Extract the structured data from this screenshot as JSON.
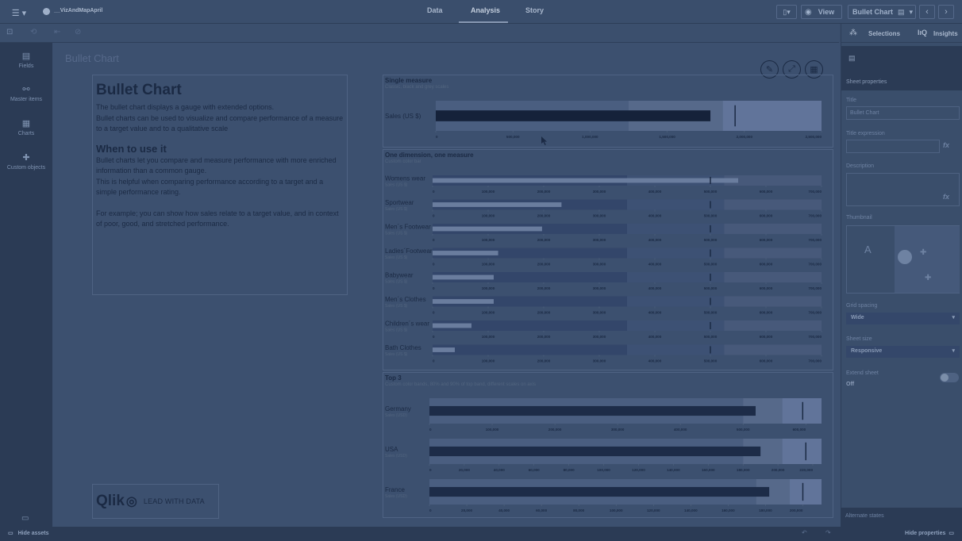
{
  "app": {
    "name": "__VizAndMapApril",
    "tabs": [
      "Data",
      "Analysis",
      "Story"
    ],
    "active_tab": "Analysis",
    "view_label": "View",
    "sheet_select": "Bullet Chart"
  },
  "toolbar": {
    "selections_label": "Selections",
    "insights_label": "Insights"
  },
  "leftnav": {
    "items": [
      {
        "label": "Fields",
        "icon": "database-icon"
      },
      {
        "label": "Master items",
        "icon": "link-icon"
      },
      {
        "label": "Charts",
        "icon": "chart-icon"
      },
      {
        "label": "Custom objects",
        "icon": "puzzle-icon"
      }
    ]
  },
  "sheet": {
    "title": "Bullet Chart"
  },
  "textbox": {
    "heading": "Bullet Chart",
    "p1": "The bullet chart displays a gauge with extended options.",
    "p2": "Bullet charts can be used to visualize and compare performance of a measure to a target value and to a qualitative scale",
    "heading2": "When to use it",
    "p3": "Bullet charts let you compare and measure performance with more enriched information than a common gauge.",
    "p4": "This is helpful when comparing performance according to a target and a simple performance rating.",
    "p5": "For example; you can show how sales relate to a target value, and in context of poor, good, and stretched performance."
  },
  "logo": {
    "brand": "Qlik",
    "tagline": "LEAD WITH DATA"
  },
  "chart_data": [
    {
      "type": "bullet",
      "title": "Single measure",
      "subtitle": "Classic, black and grey scales",
      "rows": [
        {
          "label": "Sales (US $)",
          "value": 1780000,
          "target": 1940000,
          "ranges": [
            1250000,
            1860000,
            2500000
          ]
        }
      ],
      "xlim": [
        0,
        2500000
      ],
      "ticks": [
        "0",
        "500,000",
        "1,000,000",
        "1,500,000",
        "2,000,000",
        "2,500,000"
      ]
    },
    {
      "type": "bullet",
      "title": "One dimension, one measure",
      "subtitle": "Custom color bar",
      "xlim": [
        0,
        700000
      ],
      "ticks": [
        "0",
        "100,000",
        "200,000",
        "300,000",
        "400,000",
        "500,000",
        "600,000",
        "700,000"
      ],
      "rows": [
        {
          "label": "Womens wear",
          "sublabel": "Sales (US $)",
          "value": 550000,
          "target": 500000,
          "ranges": [
            350000,
            525000,
            700000
          ]
        },
        {
          "label": "Sportwear",
          "sublabel": "Sales (US $)",
          "value": 232000,
          "target": 500000,
          "ranges": [
            350000,
            525000,
            700000
          ]
        },
        {
          "label": "Men´s Footwear",
          "sublabel": "Sales (US $)",
          "value": 197000,
          "target": 500000,
          "ranges": [
            350000,
            525000,
            700000
          ]
        },
        {
          "label": "Ladies´Footwear",
          "sublabel": "Sales (US $)",
          "value": 118000,
          "target": 500000,
          "ranges": [
            350000,
            525000,
            700000
          ]
        },
        {
          "label": "Babywear",
          "sublabel": "Sales (US $)",
          "value": 110000,
          "target": 500000,
          "ranges": [
            350000,
            525000,
            700000
          ]
        },
        {
          "label": "Men´s Clothes",
          "sublabel": "Sales (US $)",
          "value": 110000,
          "target": 500000,
          "ranges": [
            350000,
            525000,
            700000
          ]
        },
        {
          "label": "Children´s wear",
          "sublabel": "Sales (US $)",
          "value": 70000,
          "target": 500000,
          "ranges": [
            350000,
            525000,
            700000
          ]
        },
        {
          "label": "Bath Clothes",
          "sublabel": "Sales (US $)",
          "value": 40000,
          "target": 500000,
          "ranges": [
            350000,
            525000,
            700000
          ]
        }
      ]
    },
    {
      "type": "bullet",
      "title": "Top 3",
      "subtitle": "Custom color bands, 80% and 90% of top band, different scales on axis",
      "rows": [
        {
          "label": "Germany",
          "sublabel": "Sales (USD)",
          "value": 520000,
          "target": 595000,
          "ranges": [
            500000,
            562500,
            625000
          ],
          "xlim": [
            0,
            625000
          ],
          "ticks": [
            "0",
            "100,000",
            "200,000",
            "300,000",
            "400,000",
            "500,000",
            "600,000"
          ]
        },
        {
          "label": "USA",
          "sublabel": "Sales (USD)",
          "value": 190000,
          "target": 216000,
          "ranges": [
            180000,
            202500,
            225000
          ],
          "xlim": [
            0,
            225000
          ],
          "ticks": [
            "0",
            "20,000",
            "40,000",
            "60,000",
            "80,000",
            "100,000",
            "120,000",
            "140,000",
            "160,000",
            "180,000",
            "200,000",
            "220,000"
          ]
        },
        {
          "label": "France",
          "sublabel": "Sales (USD)",
          "value": 182000,
          "target": 200000,
          "ranges": [
            175000,
            193000,
            210000
          ],
          "xlim": [
            0,
            210000
          ],
          "ticks": [
            "0",
            "20,000",
            "40,000",
            "60,000",
            "80,000",
            "100,000",
            "120,000",
            "140,000",
            "160,000",
            "180,000",
            "200,000"
          ]
        }
      ]
    }
  ],
  "properties": {
    "section_title": "Sheet properties",
    "title_label": "Title",
    "title_value": "Bullet Chart",
    "title_expr_label": "Title expression",
    "description_label": "Description",
    "thumbnail_label": "Thumbnail",
    "grid_spacing_label": "Grid spacing",
    "grid_spacing_value": "Wide",
    "sheet_size_label": "Sheet size",
    "sheet_size_value": "Responsive",
    "extend_sheet_label": "Extend sheet",
    "extend_sheet_value": "Off",
    "alternate_states": "Alternate states",
    "fx": "fx"
  },
  "bottom": {
    "hide_assets": "Hide assets",
    "hide_properties": "Hide properties"
  }
}
